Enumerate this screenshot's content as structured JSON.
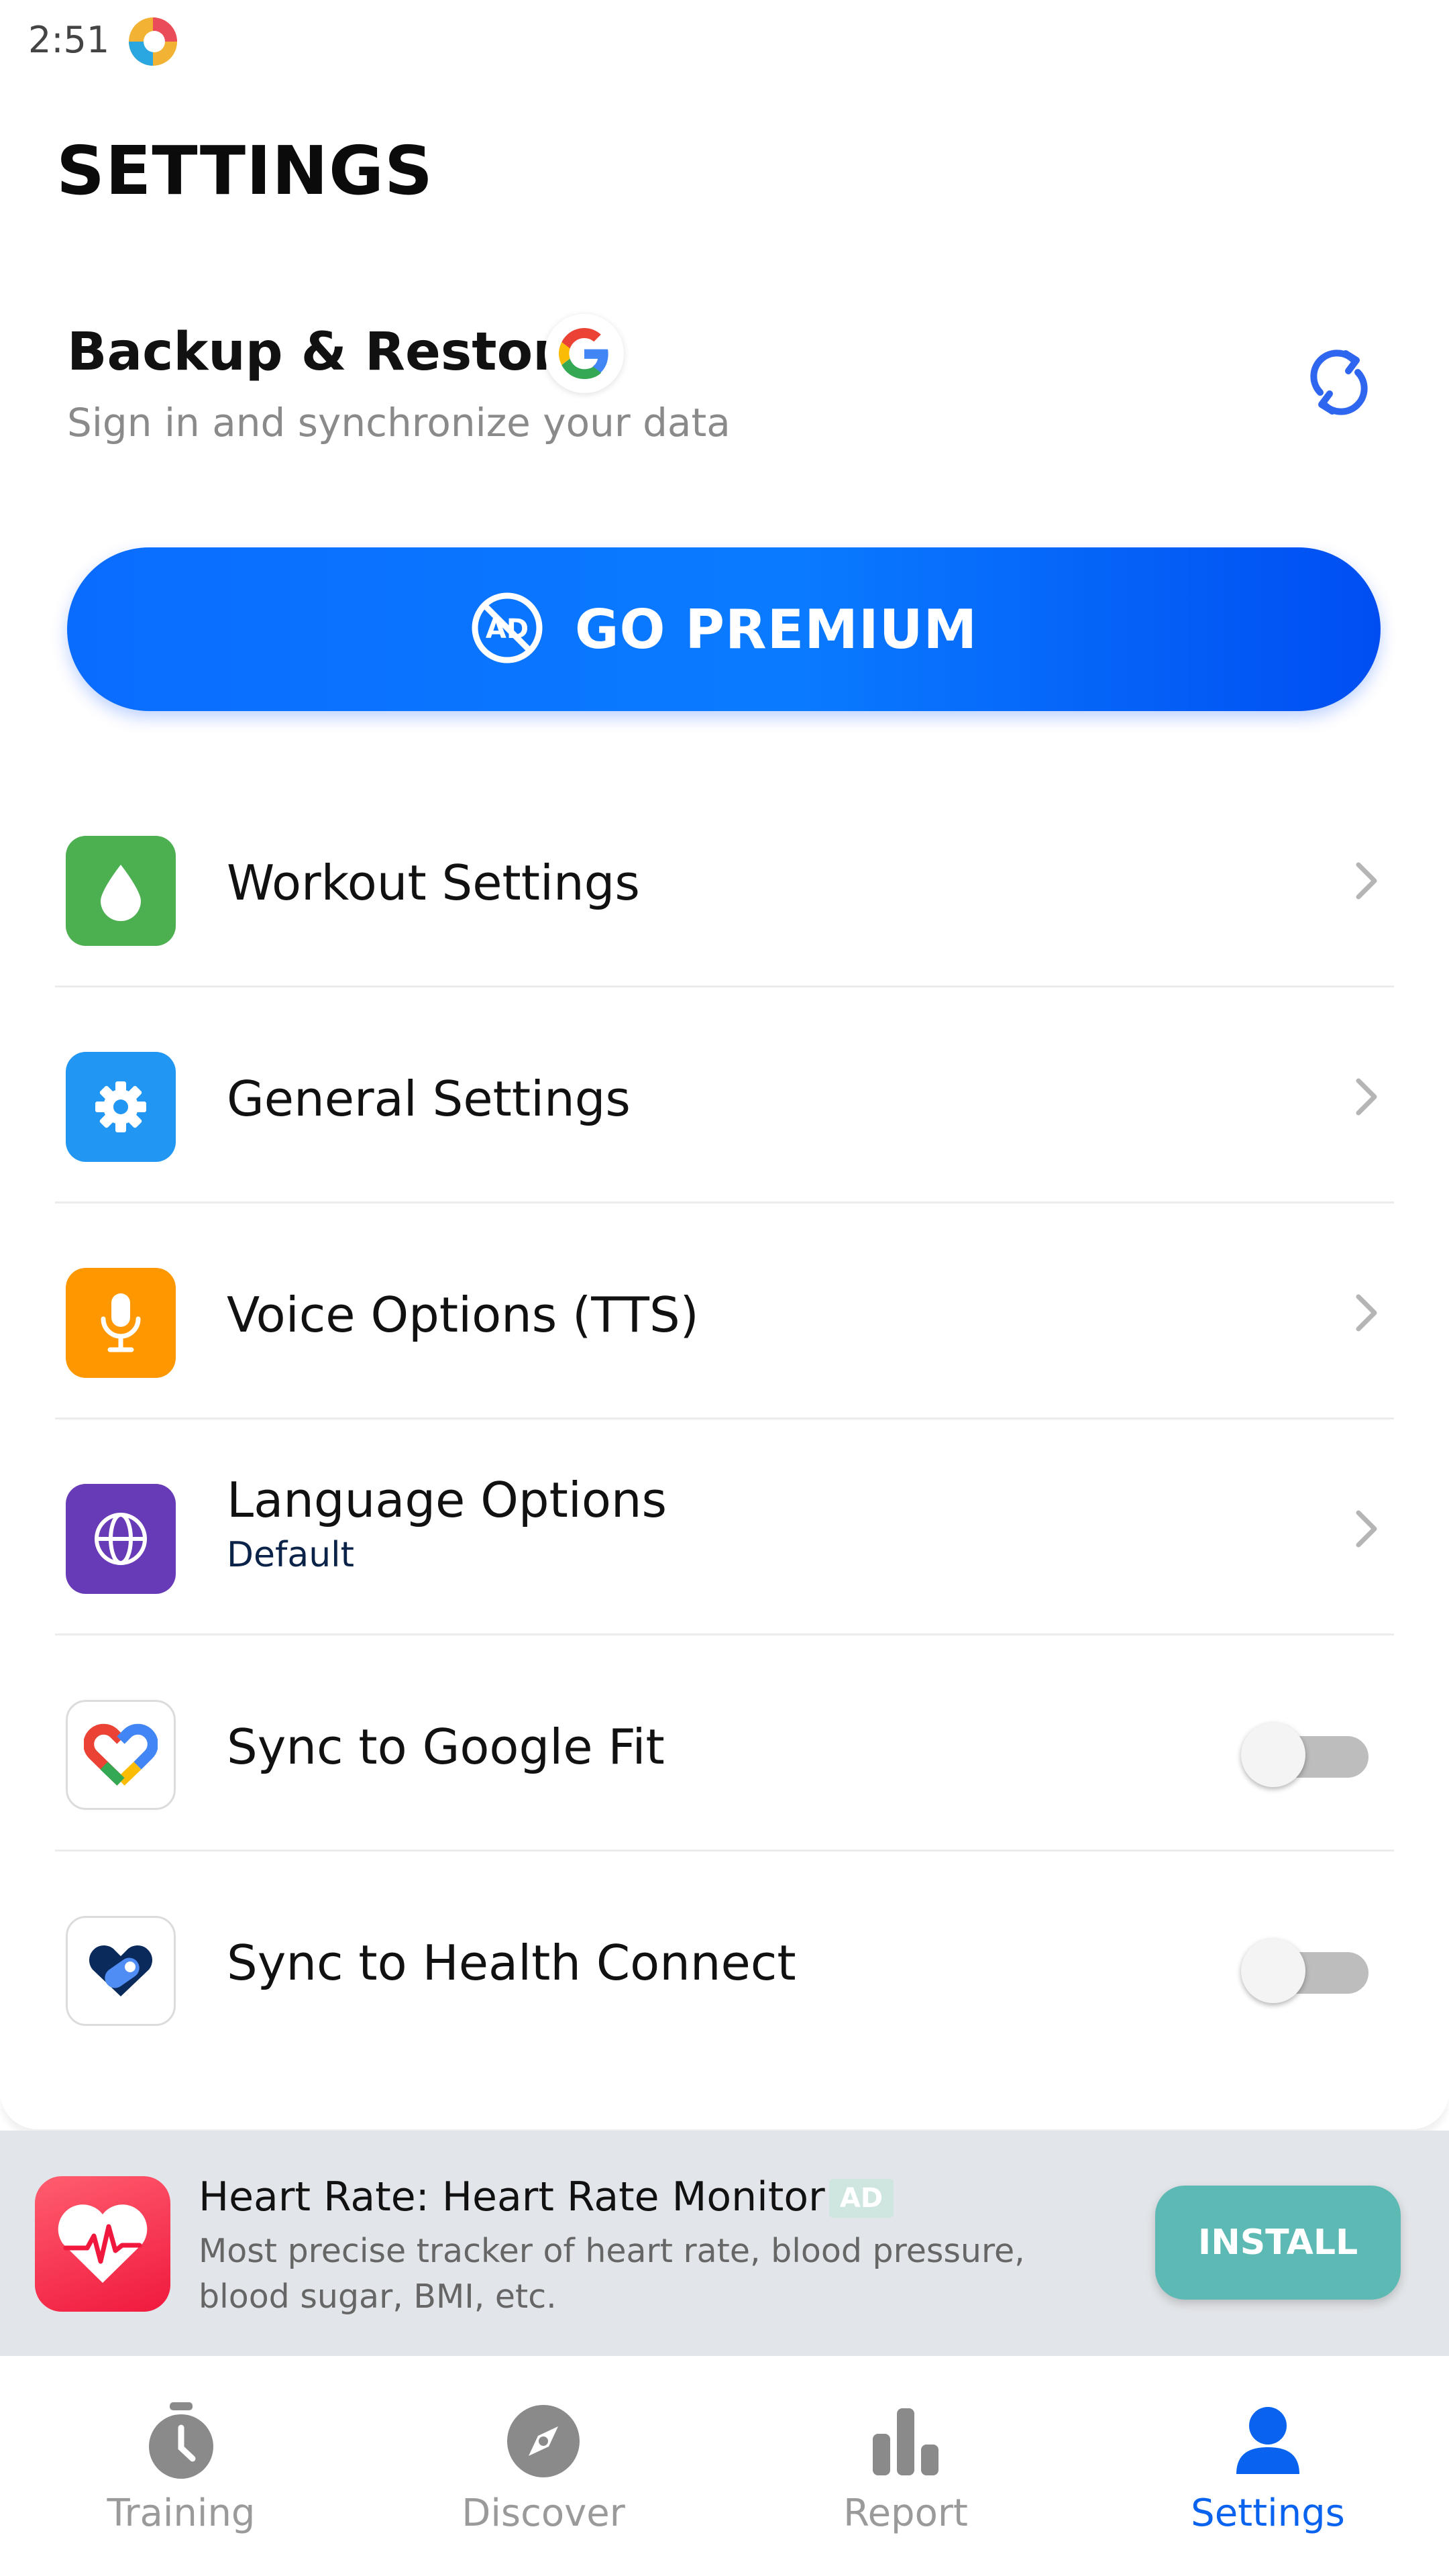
{
  "status_bar": {
    "time": "2:51",
    "app_icon": "colorful-swirl-app-icon"
  },
  "page_title": "SETTINGS",
  "backup": {
    "title": "Backup & Restore",
    "subtitle": "Sign in and synchronize your data",
    "badge_icon": "google-icon",
    "sync_icon": "sync-icon"
  },
  "premium": {
    "label": "GO PREMIUM",
    "icon": "no-ads-icon",
    "colors": [
      "#0a6cff",
      "#004ef2"
    ]
  },
  "settings_items": [
    {
      "label": "Workout Settings",
      "icon": "water-drop-icon",
      "icon_color": "#4caf50"
    },
    {
      "label": "General Settings",
      "icon": "gear-icon",
      "icon_color": "#2196f3"
    },
    {
      "label": "Voice Options (TTS)",
      "icon": "microphone-icon",
      "icon_color": "#ff9800"
    },
    {
      "label": "Language Options",
      "sublabel": "Default",
      "icon": "globe-icon",
      "icon_color": "#673ab7"
    },
    {
      "label": "Sync to Google Fit",
      "icon": "google-fit-icon",
      "toggle": false
    },
    {
      "label": "Sync to Health Connect",
      "icon": "health-connect-icon",
      "toggle": false
    }
  ],
  "ad": {
    "title": "Heart Rate: Heart Rate Monitor",
    "tag": "AD",
    "description": "Most precise tracker of heart rate, blood pressure, blood sugar, BMI, etc.",
    "install_label": "INSTALL",
    "icon": "heart-rate-icon"
  },
  "nav": {
    "items": [
      {
        "label": "Training",
        "icon": "stopwatch-icon"
      },
      {
        "label": "Discover",
        "icon": "compass-icon"
      },
      {
        "label": "Report",
        "icon": "bar-chart-icon"
      },
      {
        "label": "Settings",
        "icon": "person-icon",
        "active": true
      }
    ],
    "active_color": "#0a63ef",
    "inactive_color": "#9a9a9a"
  }
}
